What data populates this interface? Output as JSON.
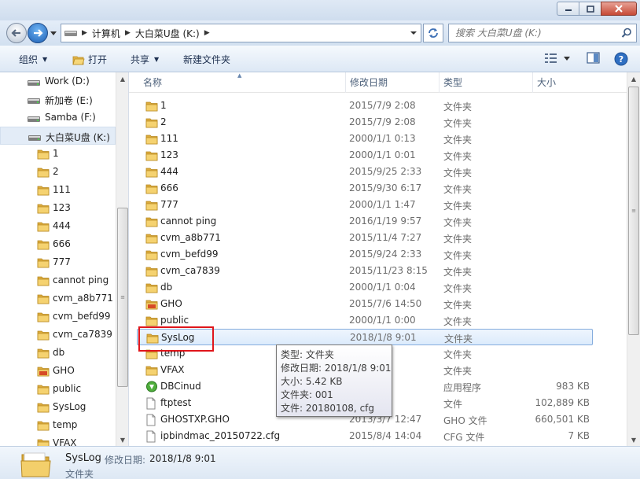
{
  "window": {
    "buttons": [
      "minimize",
      "maximize",
      "close"
    ]
  },
  "nav": {
    "breadcrumb": [
      "计算机",
      "大白菜U盘 (K:)"
    ],
    "search_placeholder": "搜索 大白菜U盘 (K:)"
  },
  "toolbar": {
    "organize": "组织",
    "open": "打开",
    "share": "共享",
    "new_folder": "新建文件夹"
  },
  "sidebar": {
    "drives": [
      {
        "label": "Work (D:)"
      },
      {
        "label": "新加卷 (E:)"
      },
      {
        "label": "Samba (F:)"
      },
      {
        "label": "大白菜U盘 (K:)",
        "selected": true
      }
    ],
    "folders": [
      {
        "label": "1",
        "icon": "folder-icon"
      },
      {
        "label": "2",
        "icon": "folder-icon"
      },
      {
        "label": "111",
        "icon": "folder-icon"
      },
      {
        "label": "123",
        "icon": "folder-icon"
      },
      {
        "label": "444",
        "icon": "folder-icon"
      },
      {
        "label": "666",
        "icon": "folder-icon"
      },
      {
        "label": "777",
        "icon": "folder-icon"
      },
      {
        "label": "cannot ping",
        "icon": "folder-icon"
      },
      {
        "label": "cvm_a8b771",
        "icon": "folder-icon"
      },
      {
        "label": "cvm_befd99",
        "icon": "folder-icon"
      },
      {
        "label": "cvm_ca7839",
        "icon": "folder-icon"
      },
      {
        "label": "db",
        "icon": "folder-icon"
      },
      {
        "label": "GHO",
        "icon": "gho-folder-icon"
      },
      {
        "label": "public",
        "icon": "folder-icon"
      },
      {
        "label": "SysLog",
        "icon": "folder-icon"
      },
      {
        "label": "temp",
        "icon": "folder-icon"
      },
      {
        "label": "VFAX",
        "icon": "folder-icon"
      }
    ]
  },
  "columns": {
    "name": "名称",
    "date": "修改日期",
    "type": "类型",
    "size": "大小"
  },
  "files": [
    {
      "name": "1",
      "date": "2015/7/9 2:08",
      "type": "文件夹",
      "size": "",
      "icon": "folder-icon"
    },
    {
      "name": "2",
      "date": "2015/7/9 2:08",
      "type": "文件夹",
      "size": "",
      "icon": "folder-icon"
    },
    {
      "name": "111",
      "date": "2000/1/1 0:13",
      "type": "文件夹",
      "size": "",
      "icon": "folder-icon"
    },
    {
      "name": "123",
      "date": "2000/1/1 0:01",
      "type": "文件夹",
      "size": "",
      "icon": "folder-icon"
    },
    {
      "name": "444",
      "date": "2015/9/25 2:33",
      "type": "文件夹",
      "size": "",
      "icon": "folder-icon"
    },
    {
      "name": "666",
      "date": "2015/9/30 6:17",
      "type": "文件夹",
      "size": "",
      "icon": "folder-icon"
    },
    {
      "name": "777",
      "date": "2000/1/1 1:47",
      "type": "文件夹",
      "size": "",
      "icon": "folder-icon"
    },
    {
      "name": "cannot ping",
      "date": "2016/1/19 9:57",
      "type": "文件夹",
      "size": "",
      "icon": "folder-icon"
    },
    {
      "name": "cvm_a8b771",
      "date": "2015/11/4 7:27",
      "type": "文件夹",
      "size": "",
      "icon": "folder-icon"
    },
    {
      "name": "cvm_befd99",
      "date": "2015/9/24 2:33",
      "type": "文件夹",
      "size": "",
      "icon": "folder-icon"
    },
    {
      "name": "cvm_ca7839",
      "date": "2015/11/23 8:15",
      "type": "文件夹",
      "size": "",
      "icon": "folder-icon"
    },
    {
      "name": "db",
      "date": "2000/1/1 0:04",
      "type": "文件夹",
      "size": "",
      "icon": "folder-icon"
    },
    {
      "name": "GHO",
      "date": "2015/7/6 14:50",
      "type": "文件夹",
      "size": "",
      "icon": "gho-folder-icon"
    },
    {
      "name": "public",
      "date": "2000/1/1 0:00",
      "type": "文件夹",
      "size": "",
      "icon": "folder-icon"
    },
    {
      "name": "SysLog",
      "date": "2018/1/8 9:01",
      "type": "文件夹",
      "size": "",
      "icon": "folder-icon",
      "selected": true
    },
    {
      "name": "temp",
      "date": "1 4:10",
      "type": "文件夹",
      "size": "",
      "icon": "folder-icon"
    },
    {
      "name": "VFAX",
      "date": "0:00",
      "type": "文件夹",
      "size": "",
      "icon": "folder-icon"
    },
    {
      "name": "DBCinud",
      "date": "14:50",
      "type": "应用程序",
      "size": "983 KB",
      "icon": "app-icon"
    },
    {
      "name": "ftptest",
      "date": "31 2:01",
      "type": "文件",
      "size": "102,889 KB",
      "icon": "file-icon"
    },
    {
      "name": "GHOSTXP.GHO",
      "date": "2013/3/7 12:47",
      "type": "GHO 文件",
      "size": "660,501 KB",
      "icon": "file-icon"
    },
    {
      "name": "ipbindmac_20150722.cfg",
      "date": "2015/8/4 14:04",
      "type": "CFG 文件",
      "size": "7 KB",
      "icon": "file-icon"
    }
  ],
  "tooltip": {
    "type": "类型: 文件夹",
    "modified": "修改日期: 2018/1/8 9:01",
    "size": "大小: 5.42 KB",
    "folders": "文件夹: 001",
    "files": "文件: 20180108, cfg"
  },
  "details": {
    "name": "SysLog",
    "label": "修改日期:",
    "value": "2018/1/8 9:01",
    "type": "文件夹"
  }
}
